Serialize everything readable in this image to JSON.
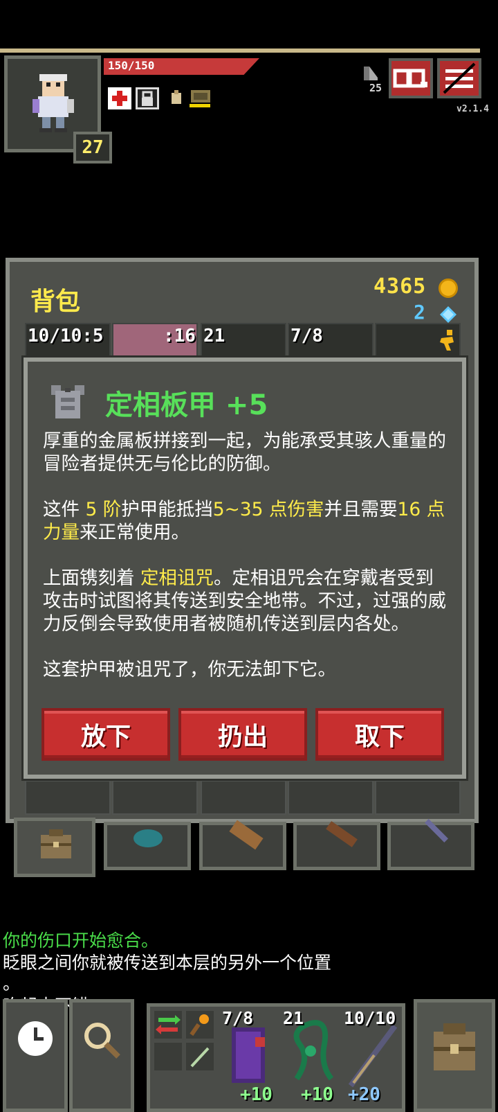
{
  "hero": {
    "hp_text": "150/150",
    "hp_fraction": 1.0,
    "level": "27",
    "depth": "25",
    "version": "v2.1.4"
  },
  "buffs": [
    "healing-cross-icon",
    "locked-icon",
    "hunger-icon",
    "armor-buff-icon"
  ],
  "top_buttons": {
    "journal": "journal-icon",
    "menu": "menu-icon"
  },
  "backpack": {
    "title": "背包",
    "gold": "4365",
    "gems": "2",
    "slot_labels": [
      "10/10:5",
      ":16",
      "21",
      "7/8",
      ""
    ]
  },
  "item": {
    "name": "定相板甲 +5",
    "desc_1": "厚重的金属板拼接到一起，为能承受其骇人重量的冒险者提供无与伦比的防御。",
    "desc_2_a": "这件 ",
    "desc_2_b": "5 阶",
    "desc_2_c": "护甲能抵挡",
    "desc_2_d": "5~35 点伤害",
    "desc_2_e": "并且需要",
    "desc_2_f": "16 点力量",
    "desc_2_g": "来正常使用。",
    "desc_3_a": "上面镌刻着 ",
    "desc_3_b": "定相诅咒",
    "desc_3_c": "。定相诅咒会在穿戴者受到攻击时试图将其传送到安全地带。不过，过强的威力反倒会导致使用者被随机传送到层内各处。",
    "desc_4": "这套护甲被诅咒了，你无法卸下它。",
    "buttons": [
      "放下",
      "扔出",
      "取下"
    ]
  },
  "log": [
    {
      "text": "你的伤口开始愈合。",
      "color": "#4ade4a"
    },
    {
      "text": "眨眼之间你就被传送到本层的另外一个位置",
      "color": "#ffffff"
    },
    {
      "text": "。",
      "color": "#ffffff"
    },
    {
      "text": "吃起来不错!",
      "color": "#ffffff"
    }
  ],
  "quickslots": [
    {
      "top": "7/8",
      "bottom": "+10",
      "icon": "spellbook-icon"
    },
    {
      "top": "21",
      "bottom": "+10",
      "icon": "vine-icon"
    },
    {
      "top": "10/10",
      "bottom": "+20",
      "icon": "wand-icon"
    }
  ],
  "colors": {
    "accent_yellow": "#ffec4a",
    "item_green": "#58e05a",
    "button_red": "#c72f2f",
    "gem_blue": "#5fc9ff"
  }
}
